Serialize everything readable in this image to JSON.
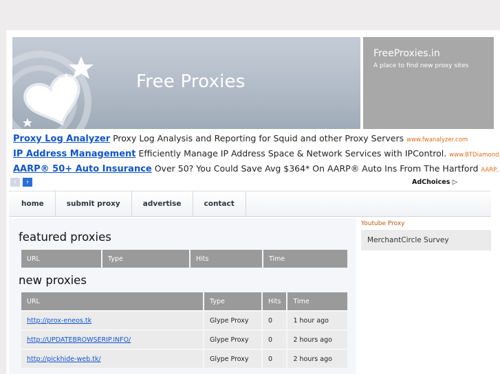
{
  "header": {
    "site_title": "Free Proxies",
    "side_title": "FreeProxies.in",
    "side_tagline": "A place to find new proxy sites"
  },
  "ads": [
    {
      "link": "Proxy Log Analyzer",
      "text": "Proxy Log Analysis and Reporting for Squid and other Proxy Servers",
      "url": "www.fwanalyzer.com"
    },
    {
      "link": "IP Address Management",
      "text": "Efficiently Manage IP Address Space & Network Services with IPControl.",
      "url": "www.BTDiamond..."
    },
    {
      "link": "AARP® 50+ Auto Insurance",
      "text": "Over 50? You Could Save Avg $364* On AARP® Auto Ins From The Hartford",
      "url": "AARP..."
    }
  ],
  "ad_nav": {
    "prev": "‹",
    "next": "›",
    "adchoices": "AdChoices ▷"
  },
  "nav": [
    "home",
    "submit proxy",
    "advertise",
    "contact"
  ],
  "featured": {
    "title": "featured proxies",
    "columns": [
      "URL",
      "Type",
      "Hits",
      "Time"
    ]
  },
  "new": {
    "title": "new proxies",
    "columns": [
      "URL",
      "Type",
      "Hits",
      "Time"
    ],
    "rows": [
      {
        "url": "http://prox-eneos.tk",
        "type": "Glype Proxy",
        "hits": "0",
        "time": "1 hour ago"
      },
      {
        "url": "http://UPDATEBROWSERIP.INFO/",
        "type": "Glype Proxy",
        "hits": "0",
        "time": "2 hours ago"
      },
      {
        "url": "http://pickhide-web.tk/",
        "type": "Glype Proxy",
        "hits": "0",
        "time": "2 hours ago"
      }
    ]
  },
  "sidebar": {
    "heading": "Youtube Proxy",
    "item": "MerchantCircle Survey"
  },
  "colors": {
    "link": "#1155cc",
    "ad_url": "#e36b1a",
    "table_header": "#9a9a9a",
    "sidebar_heading": "#c05a10"
  }
}
